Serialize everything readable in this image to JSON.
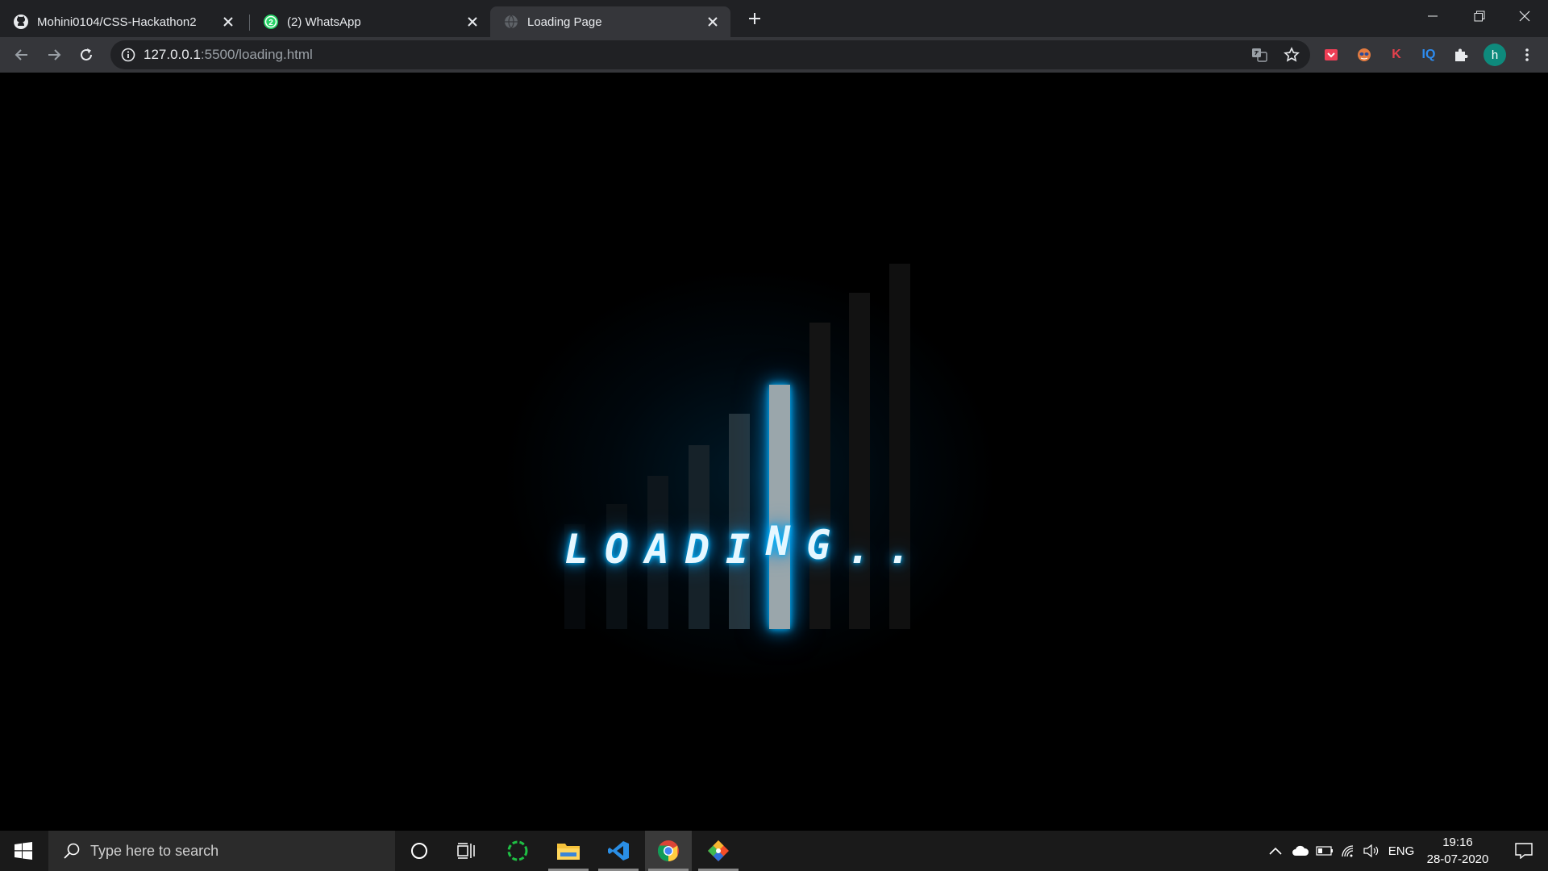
{
  "browser": {
    "tabs": [
      {
        "title": "Mohini0104/CSS-Hackathon2",
        "icon": "github-icon",
        "active": false
      },
      {
        "title": "(2) WhatsApp",
        "icon": "whatsapp-icon",
        "badge": "2",
        "active": false
      },
      {
        "title": "Loading Page",
        "icon": "globe-icon",
        "active": true
      }
    ],
    "address": {
      "host": "127.0.0.1",
      "rest": ":5500/loading.html"
    },
    "profile_initial": "h",
    "extensions": [
      "pocket-icon",
      "mask-icon",
      "k-icon",
      "iq-icon",
      "puzzle-icon"
    ],
    "extension_labels": {
      "k": "K",
      "iq": "IQ"
    }
  },
  "page": {
    "letters": [
      "L",
      "O",
      "A",
      "D",
      "I",
      "N",
      "G",
      ".",
      "."
    ],
    "accent": "#00b7ff",
    "highlight_bar_color": "#9aa6ab"
  },
  "taskbar": {
    "search_placeholder": "Type here to search",
    "apps": [
      "cortana-icon",
      "task-view-icon",
      "refresh-app-icon",
      "file-explorer-icon",
      "vscode-icon",
      "chrome-icon",
      "git-icon"
    ],
    "language": "ENG",
    "time": "19:16",
    "date": "28-07-2020"
  }
}
